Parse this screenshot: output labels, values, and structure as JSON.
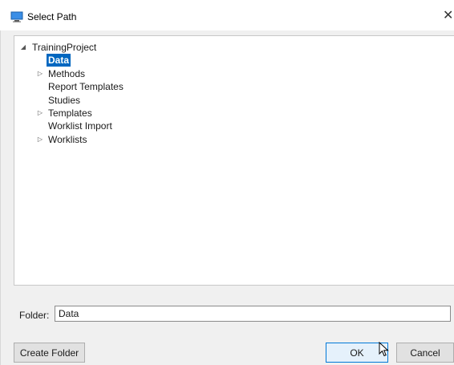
{
  "window": {
    "title": "Select Path",
    "close_glyph": "✕"
  },
  "tree": {
    "root": {
      "label": "TrainingProject",
      "expanded": true
    },
    "children": [
      {
        "label": "Data",
        "has_children": false,
        "selected": true
      },
      {
        "label": "Methods",
        "has_children": true,
        "selected": false
      },
      {
        "label": "Report Templates",
        "has_children": false,
        "selected": false
      },
      {
        "label": "Studies",
        "has_children": false,
        "selected": false
      },
      {
        "label": "Templates",
        "has_children": true,
        "selected": false
      },
      {
        "label": "Worklist Import",
        "has_children": false,
        "selected": false
      },
      {
        "label": "Worklists",
        "has_children": true,
        "selected": false
      }
    ]
  },
  "folder": {
    "label": "Folder:",
    "value": "Data"
  },
  "buttons": {
    "create_folder": "Create Folder",
    "ok": "OK",
    "cancel": "Cancel"
  },
  "icons": {
    "app": "computer-monitor-icon",
    "expanded": "expanded-triangle-icon",
    "collapsed": "collapsed-triangle-icon",
    "cursor": "mouse-pointer-icon"
  },
  "colors": {
    "selection": "#0067c0",
    "ok_border": "#0078d7"
  }
}
